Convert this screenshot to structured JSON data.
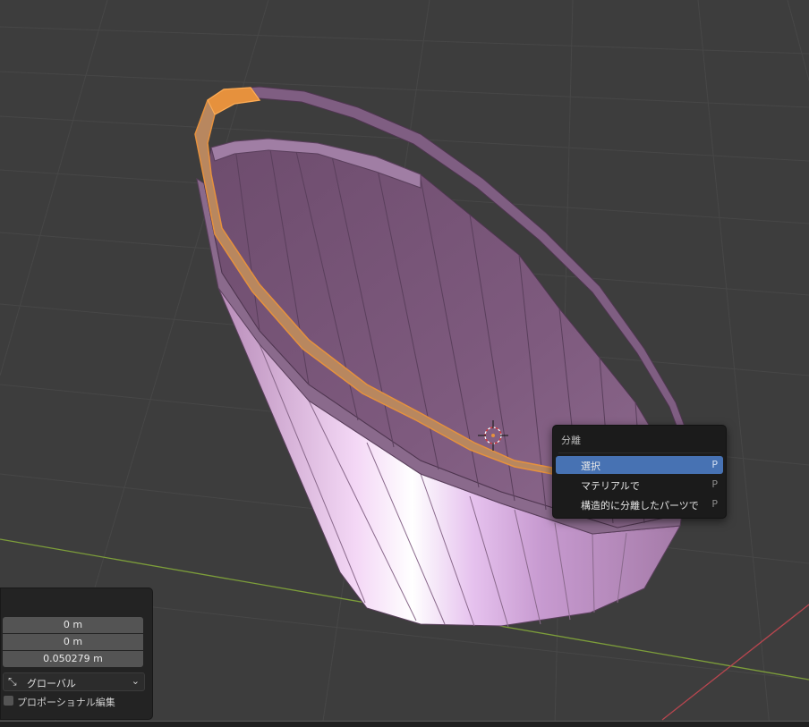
{
  "separate_menu": {
    "title": "分離",
    "items": [
      {
        "label": "選択",
        "shortcut": "P",
        "active": true
      },
      {
        "label": "マテリアルで",
        "shortcut": "P",
        "active": false
      },
      {
        "label": "構造的に分離したパーツで",
        "shortcut": "P",
        "active": false
      }
    ]
  },
  "operator_panel": {
    "values": [
      "0 m",
      "0 m",
      "0.050279 m"
    ],
    "orientation": "グローバル",
    "orientation_icon": "transform-orientation-icon",
    "proportional_label": "プロポーショナル編集",
    "proportional_checked": false
  },
  "colors": {
    "viewport_bg": "#3d3d3d",
    "mesh": "#9c7aa0",
    "selection": "#e6913d",
    "x_axis": "#b8464f",
    "y_axis": "#7d9e3a",
    "menu_highlight": "#4772b3"
  }
}
